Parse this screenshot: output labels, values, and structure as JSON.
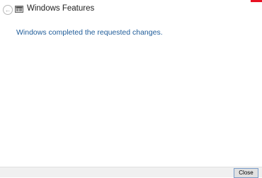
{
  "window": {
    "title": "Windows Features",
    "app_icon": "windows-features-icon",
    "back_icon": "back-arrow-icon"
  },
  "main": {
    "message": "Windows completed the requested changes."
  },
  "footer": {
    "close_label": "Close"
  },
  "colors": {
    "message_text": "#1f5c99",
    "footer_bg": "#f0f0f0",
    "close_accent": "#e81123"
  }
}
